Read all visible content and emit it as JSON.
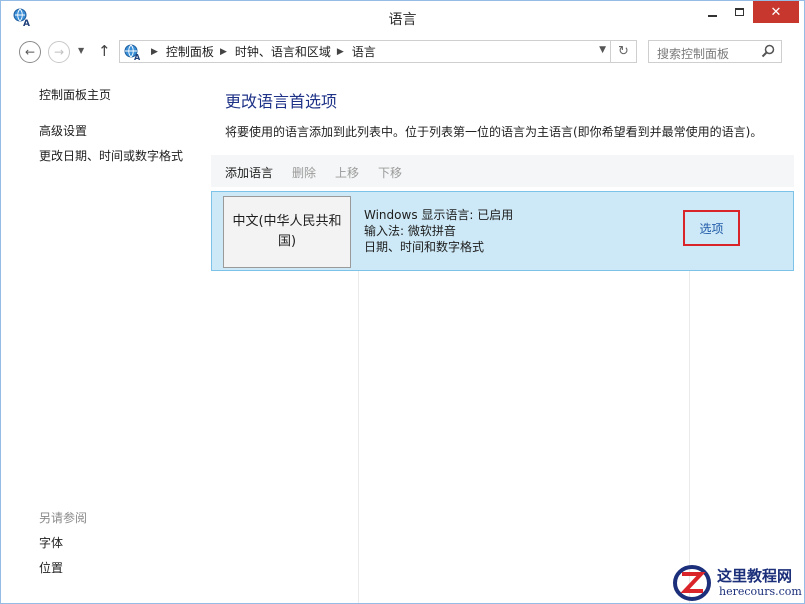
{
  "window": {
    "title": "语言"
  },
  "nav": {
    "back_icon": "arrow-left-icon",
    "forward_icon": "arrow-right-icon",
    "up_icon": "arrow-up-icon"
  },
  "address": {
    "breadcrumbs": [
      "控制面板",
      "时钟、语言和区域",
      "语言"
    ]
  },
  "search": {
    "placeholder": "搜索控制面板"
  },
  "sidebar": {
    "home": "控制面板主页",
    "links": [
      "高级设置",
      "更改日期、时间或数字格式"
    ],
    "see_also_heading": "另请参阅",
    "see_also": [
      "字体",
      "位置"
    ]
  },
  "main": {
    "title": "更改语言首选项",
    "description": "将要使用的语言添加到此列表中。位于列表第一位的语言为主语言(即你希望看到并最常使用的语言)。",
    "toolbar": {
      "add": "添加语言",
      "remove": "删除",
      "up": "上移",
      "down": "下移"
    },
    "languages": [
      {
        "name": "中文(中华人民共和国)",
        "details": [
          "Windows 显示语言: 已启用",
          "输入法: 微软拼音",
          "日期、时间和数字格式"
        ],
        "options": "选项"
      }
    ]
  },
  "watermark": {
    "title": "这里教程网",
    "url": "herecours.com"
  },
  "colors": {
    "accent_title": "#1e3287",
    "selected_row": "#cde8f6",
    "selected_border": "#7dc2e8",
    "highlight_box": "#d9242a",
    "close_button": "#c7372d"
  }
}
